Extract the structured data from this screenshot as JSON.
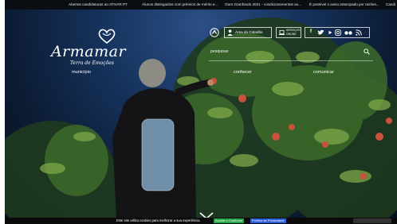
{
  "ticker": {
    "items": [
      "Abertas candidaturas ao ATIVAR.PT",
      "Alunos distinguidos com prémios de mérito e...",
      "Ouro Granfondo 2021 - condicionamentos ao...",
      "É possível o aviso antecipado por razões...",
      "Candi"
    ]
  },
  "brand": {
    "name": "Armamar",
    "tagline": "Terra de Emoções"
  },
  "header": {
    "citizen_area_label": "Área do Cidadão",
    "online_services_label": "SERVIÇOS ONLINE",
    "social": [
      "f",
      "t",
      "yt",
      "ig",
      "flickr",
      "rss"
    ]
  },
  "search": {
    "placeholder": "pesquisar"
  },
  "nav": {
    "items": [
      "município",
      "",
      "conhecer",
      "comunicar"
    ]
  },
  "cookie": {
    "message": "Este site utiliza cookies para melhorar a sua experiência.",
    "accept_label": "Aceitar e Continuar",
    "policy_label": "Política de Privacidade"
  },
  "colors": {
    "accept": "#26a646",
    "policy": "#2b5fd8",
    "sky": "#16335d"
  }
}
